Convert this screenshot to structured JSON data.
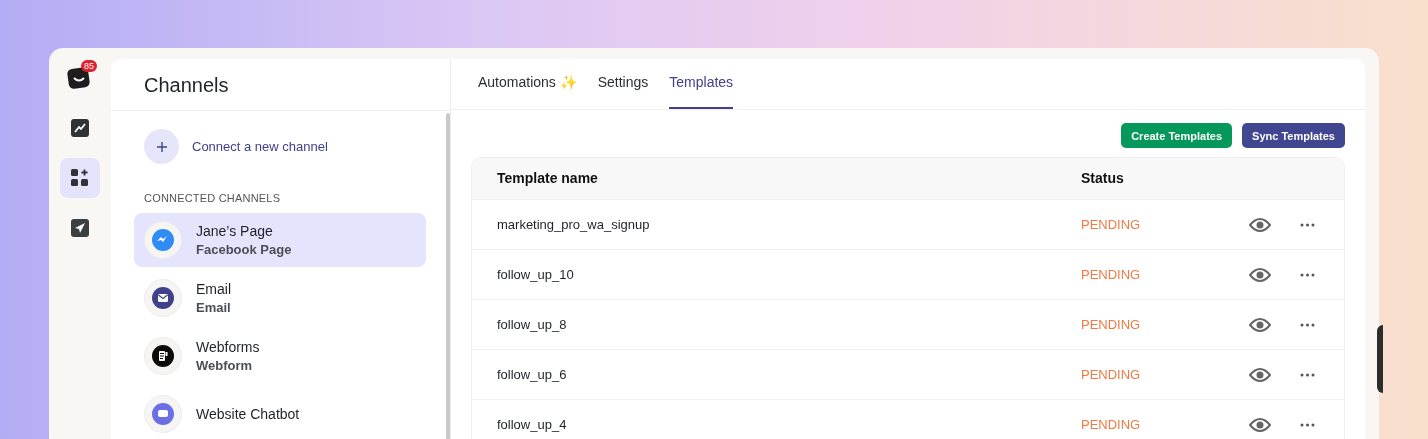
{
  "rail": {
    "badge": "85",
    "items": [
      {
        "kind": "analytics",
        "selected": false
      },
      {
        "kind": "apps",
        "selected": true
      },
      {
        "kind": "send",
        "selected": false
      }
    ]
  },
  "channels_panel": {
    "title": "Channels",
    "connect_label": "Connect a new channel",
    "section_label": "CONNECTED CHANNELS",
    "items": [
      {
        "name": "Jane’s Page",
        "type": "Facebook Page",
        "kind": "messenger",
        "selected": true
      },
      {
        "name": "Email",
        "type": "Email",
        "kind": "email",
        "selected": false
      },
      {
        "name": "Webforms",
        "type": "Webform",
        "kind": "webform",
        "selected": false
      },
      {
        "name": "Website Chatbot",
        "kind": "chatbot",
        "selected": false
      }
    ]
  },
  "tabs": [
    {
      "label": "Automations ✨",
      "selected": false
    },
    {
      "label": "Settings",
      "selected": false
    },
    {
      "label": "Templates",
      "selected": true
    }
  ],
  "buttons": [
    {
      "label": "Create Templates",
      "kind": "primary"
    },
    {
      "label": "Sync Templates",
      "kind": "secondary"
    }
  ],
  "table": {
    "columns": [
      "Template name",
      "Status"
    ],
    "rows": [
      {
        "name": "marketing_pro_wa_signup",
        "status": "PENDING"
      },
      {
        "name": "follow_up_10",
        "status": "PENDING"
      },
      {
        "name": "follow_up_8",
        "status": "PENDING"
      },
      {
        "name": "follow_up_6",
        "status": "PENDING"
      },
      {
        "name": "follow_up_4",
        "status": "PENDING"
      }
    ]
  }
}
